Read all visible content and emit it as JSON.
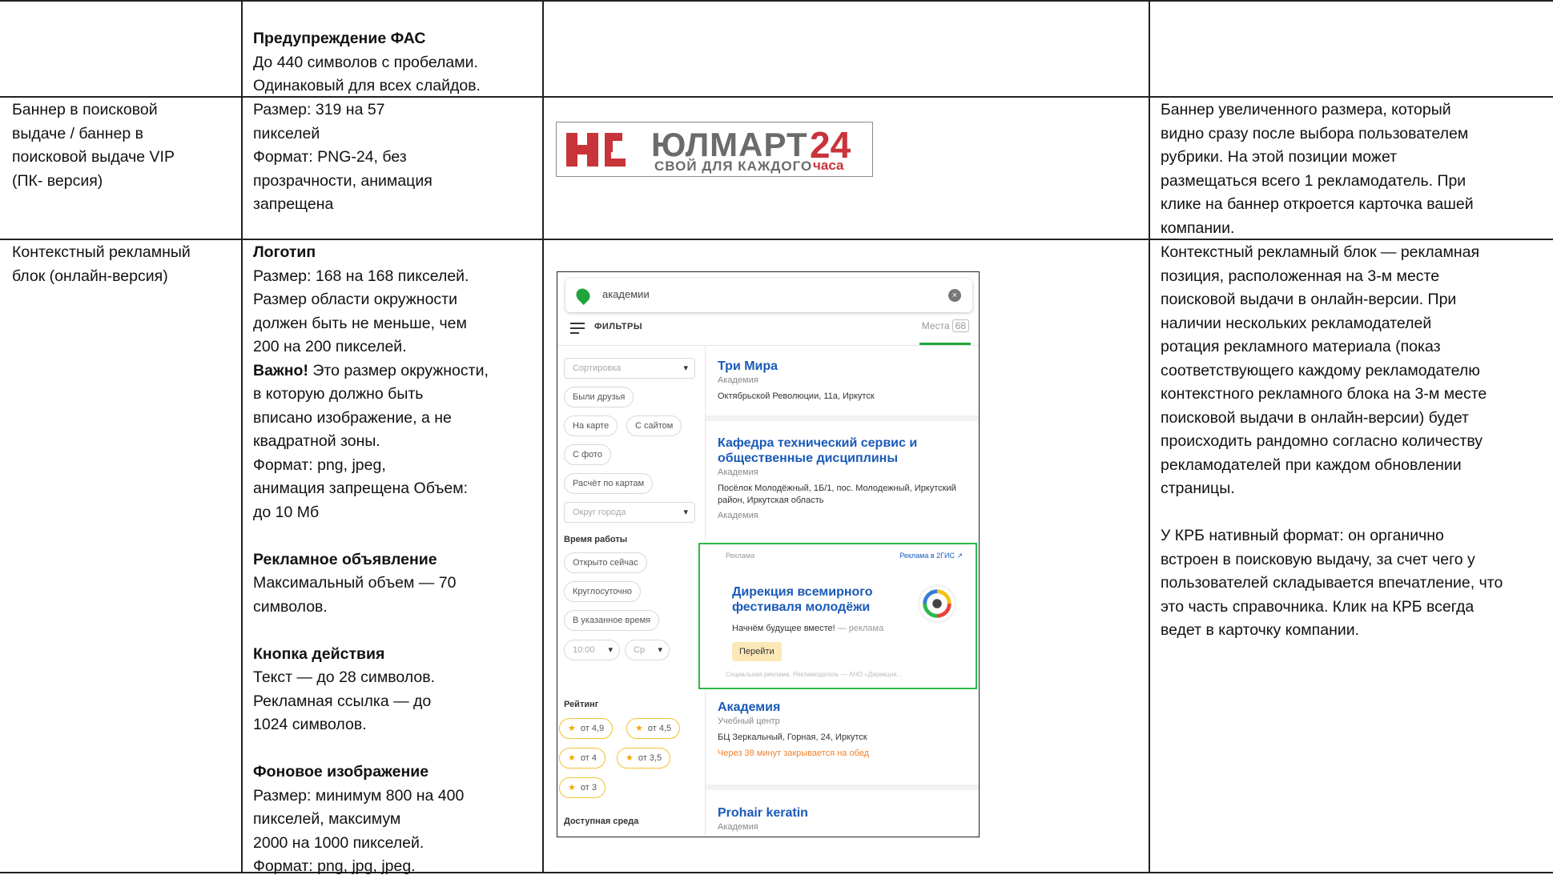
{
  "row1": {
    "col2": {
      "heading": "Предупреждение ФАС",
      "lines": [
        "До 440 символов с пробелами.",
        "Одинаковый для всех слайдов."
      ]
    }
  },
  "row2": {
    "col1": [
      "Баннер в поисковой",
      "выдаче / баннер в",
      "поисковой выдаче VIP",
      "(ПК- версия)"
    ],
    "col2": [
      "Размер: 319 на 57",
      "пикселей",
      "Формат: PNG-24, без",
      "прозрачности, анимация",
      "запрещена"
    ],
    "banner": {
      "brand": "ЮЛМАРТ",
      "tagline": "СВОЙ ДЛЯ КАЖДОГО",
      "number": "24",
      "hours": "часа",
      "brand_color": "#6b6b6b",
      "accent_color": "#c8343a"
    },
    "col4": [
      "Баннер увеличенного размера, который",
      "видно сразу после выбора пользователем",
      "рубрики. На этой позиции может",
      "размещаться всего 1 рекламодатель. При",
      "клике на баннер откроется карточка вашей",
      "компании."
    ]
  },
  "row3": {
    "col1": [
      "Контекстный рекламный",
      "блок (онлайн-версия)"
    ],
    "col2": {
      "logo_heading": "Логотип",
      "logo_lines": [
        "Размер: 168 на 168 пикселей.",
        "Размер области окружности",
        "должен быть не меньше, чем",
        "200 на 200 пикселей."
      ],
      "important_bold": "Важно!",
      "important_rest": " Это размер окружности,",
      "important_lines": [
        "в которую должно быть",
        "вписано изображение, а не",
        "квадратной зоны.",
        "Формат: png, jpeg,",
        "анимация запрещена Объем:",
        "до 10 Мб"
      ],
      "ad_heading": "Рекламное объявление",
      "ad_lines": [
        "Максимальный объем — 70",
        "символов."
      ],
      "cta_heading": "Кнопка действия",
      "cta_lines": [
        "Текст — до 28 символов.",
        "Рекламная ссылка  —  до",
        "1024 символов."
      ],
      "bg_heading": "Фоновое изображение",
      "bg_lines": [
        "Размер: минимум 800 на 400",
        "пикселей, максимум",
        "2000 на 1000 пикселей.",
        "Формат: png, jpg, jpeg."
      ]
    },
    "col4": {
      "p1": [
        "Контекстный рекламный блок — рекламная",
        "позиция, расположенная на 3-м месте",
        "поисковой выдачи в онлайн-версии. При",
        "наличии нескольких рекламодателей",
        "ротация рекламного материала (показ",
        "соответствующего каждому рекламодателю",
        "контекстного рекламного блока на 3-м месте",
        "поисковой выдачи в онлайн-версии) будет",
        "происходить рандомно согласно количеству",
        "рекламодателей при каждом обновлении",
        "страницы."
      ],
      "p2": [
        "У КРБ нативный формат: он органично",
        "встроен в поисковую выдачу, за счет чего у",
        "пользователей складывается впечатление, что",
        "это часть справочника. Клик на КРБ всегда",
        "ведет в карточку компании."
      ]
    },
    "mockup": {
      "search_query": "академии",
      "filters_label": "ФИЛЬТРЫ",
      "places_label": "Места",
      "places_count": "68",
      "sort_placeholder": "Сортировка",
      "chips_top": [
        "Были друзья",
        "На карте",
        "С сайтом",
        "С фото",
        "Расчёт по картам"
      ],
      "district_placeholder": "Округ города",
      "hours_title": "Время работы",
      "hours_chips": [
        "Открыто сейчас",
        "Круглосуточно",
        "В указанное время"
      ],
      "time_value": "10:00",
      "day_value": "Ср",
      "rating_title": "Рейтинг",
      "rating_chips": [
        "от 4,9",
        "от 4,5",
        "от 4",
        "от 3,5",
        "от 3"
      ],
      "access_title": "Доступная среда",
      "results": [
        {
          "title": "Три Мира",
          "category": "Академия",
          "address": "Октябрьской Революции, 11а, Иркутск"
        },
        {
          "title": "Кафедра технический сервис и общественные дисциплины",
          "category": "Академия",
          "address": "Посёлок Молодёжный, 1Б/1, пос. Молодежный, Иркутский район, Иркутская область",
          "category2": "Академия"
        },
        {
          "title": "Академия",
          "category": "Учебный центр",
          "address": "БЦ Зеркальный, Горная, 24, Иркутск",
          "note": "Через 38 минут закрывается на обед"
        },
        {
          "title": "Prohair keratin",
          "category": "Академия"
        }
      ],
      "ad": {
        "label": "Реклама",
        "link": "Реклама в 2ГИС ↗",
        "title": "Дирекция всемирного фестиваля молодёжи",
        "subtitle": "Начнём будущее вместе!",
        "subtitle_suffix": " — реклама",
        "button": "Перейти",
        "disclaimer": "Социальная реклама. Рекламодатель — АНО «Дирекция..."
      },
      "accent_green": "#2eb84a",
      "link_blue": "#1a5ab8"
    }
  }
}
